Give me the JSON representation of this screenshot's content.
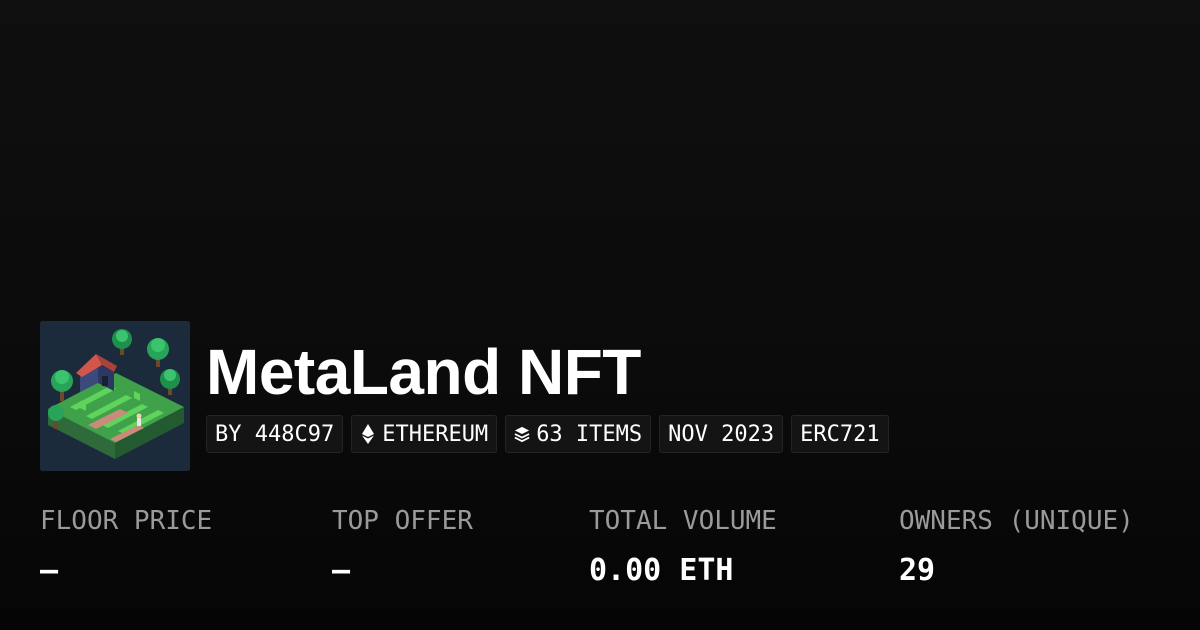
{
  "collection": {
    "name": "MetaLand NFT",
    "thumbnail_icon": "isometric-voxel-land-image",
    "tags": {
      "creator": "BY 448C97",
      "chain": "ETHEREUM",
      "chain_icon": "ethereum-icon",
      "items": "63 ITEMS",
      "items_icon": "layers-icon",
      "date": "NOV 2023",
      "standard": "ERC721"
    }
  },
  "stats": {
    "floor_price": {
      "label": "FLOOR PRICE",
      "value": "–"
    },
    "top_offer": {
      "label": "TOP OFFER",
      "value": "–"
    },
    "total_volume": {
      "label": "TOTAL VOLUME",
      "value": "0.00 ETH"
    },
    "owners": {
      "label": "OWNERS (UNIQUE)",
      "value": "29"
    }
  },
  "colors": {
    "background": "#0b0b0b",
    "text_primary": "#ffffff",
    "text_secondary": "#9a9a9a",
    "tag_background": "#141414",
    "tag_border": "#242424"
  }
}
